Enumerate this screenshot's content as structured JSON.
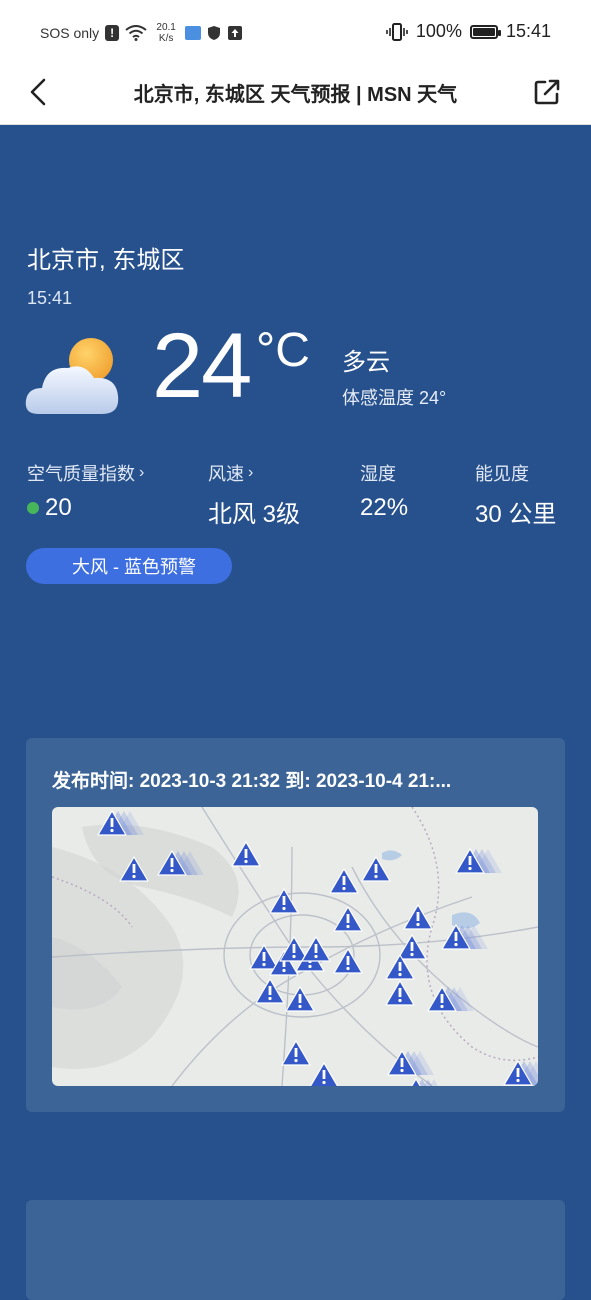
{
  "status_bar": {
    "carrier": "SOS only",
    "net_speed_value": "20.1",
    "net_speed_unit": "K/s",
    "battery": "100%",
    "battery_level": 1.0,
    "time": "15:41"
  },
  "header": {
    "title": "北京市, 东城区 天气预报 | MSN 天气"
  },
  "weather": {
    "location": "北京市, 东城区",
    "time": "15:41",
    "temperature": "24",
    "unit": "°C",
    "condition": "多云",
    "feels_like": "体感温度 24°",
    "icon": "partly-cloudy-icon"
  },
  "metrics": {
    "aqi": {
      "label": "空气质量指数",
      "value": "20",
      "dot_color": "#47b65a"
    },
    "wind": {
      "label": "风速",
      "value": "北风 3级"
    },
    "humidity": {
      "label": "湿度",
      "value": "22%"
    },
    "visibility": {
      "label": "能见度",
      "value": "30 公里"
    }
  },
  "alert": {
    "label": "大风 - 蓝色预警",
    "color": "#3e6fe0"
  },
  "alert_card": {
    "title": "发布时间: 2023-10-3 21:32 到: 2023-10-4 21:..."
  },
  "colors": {
    "background": "#27518d",
    "card": "#3c6497",
    "warning_icon": "#3558c9"
  }
}
